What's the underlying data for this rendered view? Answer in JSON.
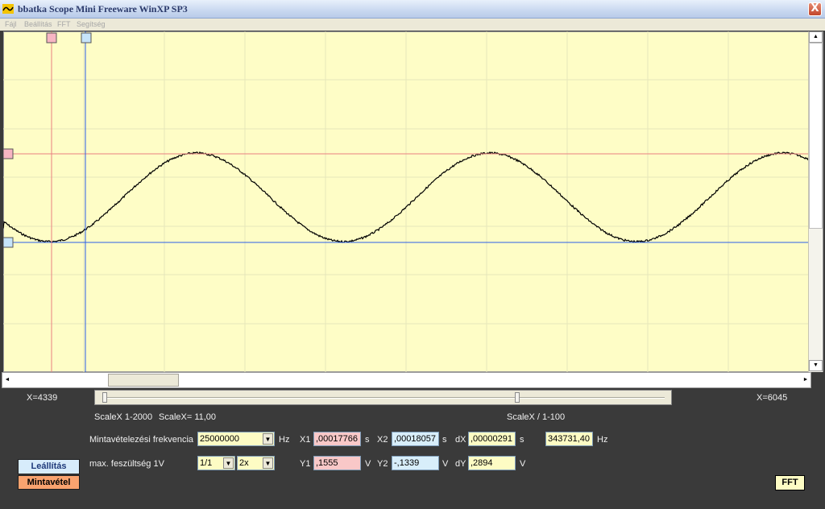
{
  "window": {
    "title": "bbatka Scope Mini Freeware WinXP SP3",
    "close_label": "X",
    "icon": "scope-app-icon"
  },
  "menu": {
    "items": [
      "Fájl",
      "Beállítás",
      "FFT",
      "Segítség"
    ]
  },
  "plot": {
    "background": "#fefdc6",
    "grid_color": "#e6e6ba",
    "trace_color": "#000000",
    "cursor1_color": "#e98080",
    "cursor2_color": "#2a5ee8",
    "marker_pink": "#f7b5c3",
    "marker_blue": "#c6e4fa"
  },
  "scrollbars": {
    "up_arrow": "▲",
    "down_arrow": "▼",
    "left_arrow": "◄",
    "right_arrow": "►"
  },
  "slider": {
    "left_readout": "X=4339",
    "right_readout": "X=6045"
  },
  "scale": {
    "range_label": "ScaleX 1-2000",
    "value_label": "ScaleX= 11,00",
    "divider_label": "ScaleX / 1-100"
  },
  "sampling": {
    "label": "Mintavételezési frekvencia",
    "value": "25000000",
    "unit": "Hz"
  },
  "voltage": {
    "label": "max. feszültség  1V",
    "divider": "1/1",
    "gain": "2x"
  },
  "cursors": {
    "x1_label": "X1",
    "x1_value": ",00017766",
    "x1_unit": "s",
    "x2_label": "X2",
    "x2_value": ",00018057",
    "x2_unit": "s",
    "dx_label": "dX",
    "dx_value": ",00000291",
    "dx_unit": "s",
    "freq_value": "343731,40",
    "freq_unit": "Hz",
    "y1_label": "Y1",
    "y1_value": ",1555",
    "y1_unit": "V",
    "y2_label": "Y2",
    "y2_value": "-,1339",
    "y2_unit": "V",
    "dy_label": "dY",
    "dy_value": ",2894",
    "dy_unit": "V"
  },
  "buttons": {
    "stop": "Leállítás",
    "sample": "Mintavétel",
    "fft": "FFT"
  }
}
